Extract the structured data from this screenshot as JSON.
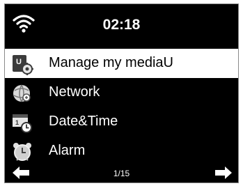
{
  "status": {
    "time": "02:18",
    "signal_icon": "wifi-signal-icon"
  },
  "menu": {
    "items": [
      {
        "label": "Manage my mediaU",
        "icon": "mediau-manage-icon",
        "selected": true
      },
      {
        "label": "Network",
        "icon": "network-icon",
        "selected": false
      },
      {
        "label": "Date&Time",
        "icon": "date-time-icon",
        "selected": false
      },
      {
        "label": "Alarm",
        "icon": "alarm-clock-icon",
        "selected": false
      }
    ]
  },
  "footer": {
    "page_indicator": "1/15",
    "left_icon": "arrow-left-icon",
    "right_icon": "arrow-right-icon"
  },
  "colors": {
    "background": "#000000",
    "foreground": "#ffffff",
    "selected_bg": "#ffffff",
    "selected_fg": "#000000"
  }
}
